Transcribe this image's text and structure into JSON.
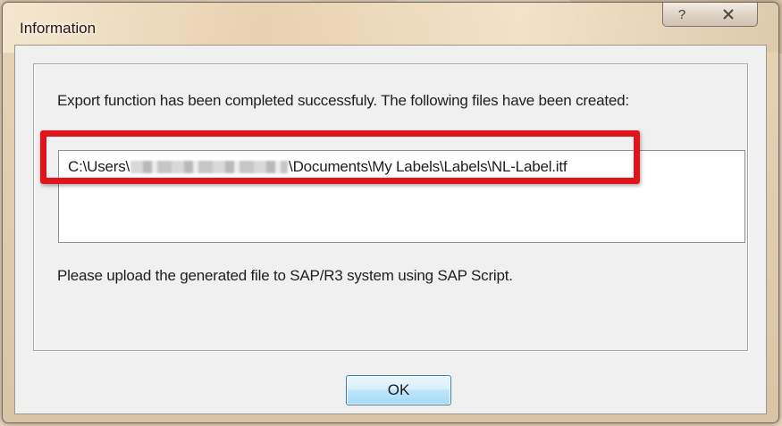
{
  "window": {
    "title": "Information",
    "help_glyph": "?",
    "close_icon": "close-icon"
  },
  "dialog": {
    "message": "Export function has been completed successfuly. The following files have been created:",
    "files": [
      {
        "path_prefix": "C:\\Users\\",
        "path_suffix": "\\Documents\\My Labels\\Labels\\NL-Label.itf"
      }
    ],
    "note": "Please upload the generated file to SAP/R3 system using SAP Script.",
    "ok_label": "OK"
  },
  "colors": {
    "highlight": "#e0141a",
    "window_bg": "#f0f0f0"
  }
}
